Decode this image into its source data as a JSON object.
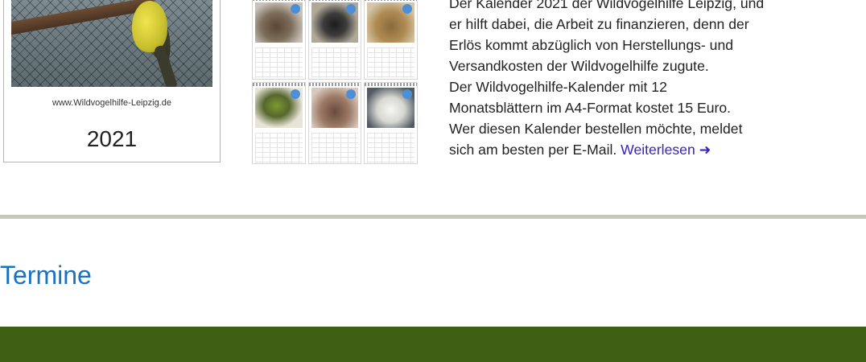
{
  "calendar_cover": {
    "website": "www.Wildvogelhilfe-Leipzig.de",
    "year": "2021"
  },
  "month_sheets": [
    {
      "photo_colors": [
        "#5a4634",
        "#c9c2b8"
      ]
    },
    {
      "photo_colors": [
        "#1d1d1d",
        "#b0a898"
      ]
    },
    {
      "photo_colors": [
        "#8a6a3c",
        "#d5c6a8"
      ]
    },
    {
      "photo_colors": [
        "#7c9a2e",
        "#e9e4d8"
      ]
    },
    {
      "photo_colors": [
        "#6a4a3a",
        "#d9c8bb"
      ]
    },
    {
      "photo_colors": [
        "#f6f6f2",
        "#535a64"
      ]
    }
  ],
  "article": {
    "lines": [
      "Der Kalender 2021 der Wildvogelhilfe Leipzig, und",
      "er hilft dabei, die Arbeit zu finanzieren, denn der",
      "Erlös kommt abzüglich von Herstellungs- und",
      "Versandkosten der Wildvogelhilfe zugute.",
      "Der Wildvogelhilfe-Kalender mit 12",
      "Monatsblättern im A4-Format kostet 15 Euro.",
      "Wer diesen Kalender bestellen möchte, meldet",
      "sich am besten per E-Mail."
    ],
    "read_more_label": "Weiterlesen",
    "read_more_arrow": "➜"
  },
  "section": {
    "title": "Termine"
  },
  "colors": {
    "link": "#3a21c1",
    "heading": "#1a73c2",
    "divider": "#c8c8b6",
    "green_bar": "#3e5f14"
  }
}
